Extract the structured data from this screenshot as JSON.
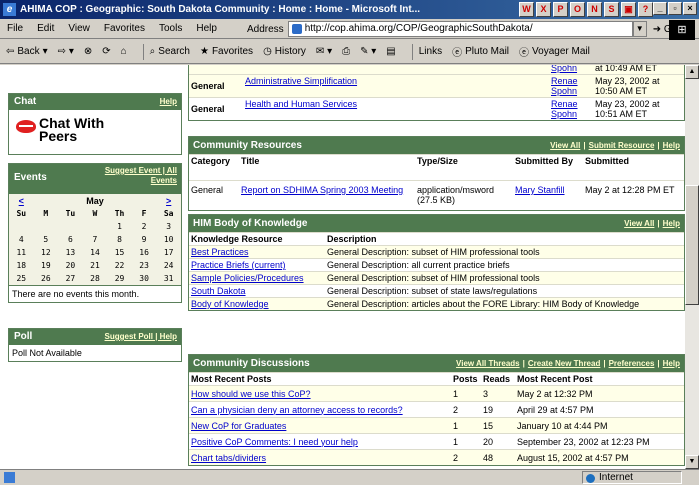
{
  "window": {
    "title": "AHIMA COP : Geographic: South Dakota Community : Home : Home - Microsoft Int...",
    "buttons": [
      "_",
      "▫",
      "×"
    ]
  },
  "menu": [
    "File",
    "Edit",
    "View",
    "Favorites",
    "Tools",
    "Help"
  ],
  "address": {
    "label": "Address",
    "url": "http://cop.ahima.org/COP/GeographicSouthDakota/",
    "go": "Go"
  },
  "toolbar": {
    "back": "Back",
    "search": "Search",
    "favorites": "Favorites",
    "history": "History",
    "links": "Links",
    "pluto": "Pluto Mail",
    "voyager": "Voyager Mail"
  },
  "status": {
    "zone": "Internet"
  },
  "chat": {
    "title": "Chat",
    "help": "Help",
    "text1": "Chat With",
    "text2": "Peers"
  },
  "events": {
    "title": "Events",
    "suggest": "Suggest Event | All",
    "events_link": "Events",
    "month": "May",
    "prev": "<",
    "next": ">",
    "days": [
      "Su",
      "M",
      "Tu",
      "W",
      "Th",
      "F",
      "Sa"
    ],
    "weeks": [
      [
        "",
        "",
        "",
        "",
        "1",
        "2",
        "3"
      ],
      [
        "4",
        "5",
        "6",
        "7",
        "8",
        "9",
        "10"
      ],
      [
        "11",
        "12",
        "13",
        "14",
        "15",
        "16",
        "17"
      ],
      [
        "18",
        "19",
        "20",
        "21",
        "22",
        "23",
        "24"
      ],
      [
        "25",
        "26",
        "27",
        "28",
        "29",
        "30",
        "31"
      ]
    ],
    "none": "There are no events this month."
  },
  "poll": {
    "title": "Poll",
    "links": "Suggest Poll | Help",
    "body": "Poll Not Available"
  },
  "top_rows": [
    {
      "cat": "General",
      "title": "Administrative Simplification",
      "by": "Renae Spohn",
      "date": "May 23, 2002 at 10:50 AM ET"
    },
    {
      "cat": "General",
      "title": "Health and Human Services",
      "by": "Renae Spohn",
      "date": "May 23, 2002 at 10:51 AM ET"
    }
  ],
  "top_partial": {
    "by": "Spohn",
    "date": "at 10:49 AM ET"
  },
  "resources": {
    "title": "Community Resources",
    "links": [
      "View All",
      "|",
      "Submit Resource",
      "|",
      "Help"
    ],
    "headers": {
      "cat": "Category",
      "title": "Title",
      "type": "Type/Size",
      "by": "Submitted By",
      "date": "Submitted"
    },
    "rows": [
      {
        "cat": "General",
        "title": "Report on SDHIMA Spring 2003 Meeting",
        "type": "application/msword (27.5 KB)",
        "by": "Mary Stanfill",
        "date": "May 2 at 12:28 PM ET"
      }
    ]
  },
  "him": {
    "title": "HIM Body of Knowledge",
    "links": [
      "View All",
      "|",
      "Help"
    ],
    "headers": {
      "res": "Knowledge Resource",
      "desc": "Description"
    },
    "rows": [
      {
        "res": "Best Practices",
        "desc": "General Description: subset of HIM professional tools"
      },
      {
        "res": "Practice Briefs (current)",
        "desc": "General Description: all current practice briefs"
      },
      {
        "res": "Sample Policies/Procedures",
        "desc": "General Description: subset of HIM professional tools"
      },
      {
        "res": "South Dakota",
        "desc": "General Description: subset of state laws/regulations"
      },
      {
        "res": "Body of Knowledge",
        "desc": "General Description: articles about the FORE Library: HIM Body of Knowledge"
      }
    ]
  },
  "discussions": {
    "title": "Community Discussions",
    "links": [
      "View All Threads",
      "|",
      "Create New Thread",
      "|",
      "Preferences",
      "|",
      "Help"
    ],
    "headers": {
      "post": "Most Recent Posts",
      "posts": "Posts",
      "reads": "Reads",
      "recent": "Most Recent Post"
    },
    "rows": [
      {
        "post": "How should we use this CoP?",
        "posts": "1",
        "reads": "3",
        "recent": "May 2 at 12:32 PM"
      },
      {
        "post": "Can a physician deny an attorney access to records?",
        "posts": "2",
        "reads": "19",
        "recent": "April 29 at 4:57 PM"
      },
      {
        "post": "New CoP for Graduates",
        "posts": "1",
        "reads": "15",
        "recent": "January 10 at 4:44 PM"
      },
      {
        "post": "Positive CoP Comments: I need your help",
        "posts": "1",
        "reads": "20",
        "recent": "September 23, 2002 at 12:23 PM"
      },
      {
        "post": "Chart tabs/dividers",
        "posts": "2",
        "reads": "48",
        "recent": "August 15, 2002 at 4:57 PM"
      }
    ]
  }
}
